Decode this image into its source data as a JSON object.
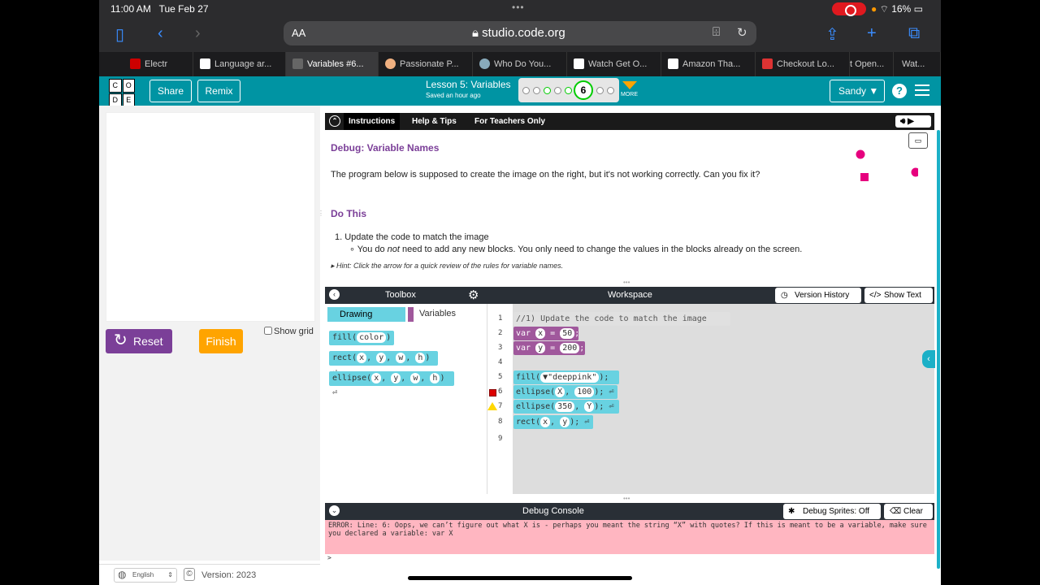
{
  "status": {
    "time": "11:00 AM",
    "date": "Tue Feb 27",
    "battery": "16%"
  },
  "safari": {
    "aa": "AA",
    "url": "studio.code.org"
  },
  "tabs": [
    {
      "label": "Electr",
      "color": "#c00"
    },
    {
      "label": "Language ar...",
      "color": "#fff"
    },
    {
      "label": "Variables #6...",
      "color": "#ccc",
      "active": true
    },
    {
      "label": "Passionate P...",
      "color": "#f0b080"
    },
    {
      "label": "Who Do You...",
      "color": "#8ab"
    },
    {
      "label": "Watch Get O...",
      "color": "#fff"
    },
    {
      "label": "Amazon Tha...",
      "color": "#fff"
    },
    {
      "label": "Checkout Lo...",
      "color": "#d33"
    },
    {
      "label": "t Open...",
      "color": "#1c1c1e"
    },
    {
      "label": "Wat...",
      "color": "#1c1c1e"
    }
  ],
  "header": {
    "logo": [
      "C",
      "O",
      "D",
      "E"
    ],
    "share": "Share",
    "remix": "Remix",
    "lesson_title": "Lesson 5: Variables",
    "saved": "Saved an hour ago",
    "current_level": "6",
    "more": "MORE",
    "user": "Sandy ▼",
    "help": "?"
  },
  "left": {
    "reset": "Reset",
    "finish": "Finish",
    "show_grid": "Show grid",
    "language": "English",
    "version": "Version: 2023"
  },
  "instructions": {
    "tabs": [
      "Instructions",
      "Help & Tips",
      "For Teachers Only"
    ],
    "title": "Debug: Variable Names",
    "body": "The program below is supposed to create the image on the right, but it's not working correctly. Can you fix it?",
    "do_this": "Do This",
    "step1": "1.  Update the code to match the image",
    "step1a_pre": "You do ",
    "step1a_em": "not",
    "step1a_post": " need to add any new blocks. You only need to change the values in the blocks already on the screen.",
    "hint": "▸ Hint: Click the arrow for a quick review of the rules for variable names."
  },
  "toolbox": {
    "title": "Toolbox",
    "cat_drawing": "Drawing",
    "cat_variables": "Variables",
    "blocks": [
      "fill",
      "rect",
      "ellipse"
    ]
  },
  "workspace": {
    "title": "Workspace",
    "version_history": "Version History",
    "show_text": "Show Text",
    "lines": [
      "1",
      "2",
      "3",
      "4",
      "5",
      "6",
      "7",
      "8",
      "9"
    ],
    "comment": "//1) Update the code to match the image",
    "code": {
      "var1_name": "x",
      "var1_val": "50",
      "var2_name": "y",
      "var2_val": "200",
      "fill_val": "▼\"deeppink\"",
      "ell1_a": "X",
      "ell1_b": "100",
      "ell2_a": "350",
      "ell2_b": "Y",
      "rect_a": "x",
      "rect_b": "y"
    }
  },
  "debug": {
    "title": "Debug Console",
    "sprites": "Debug Sprites: Off",
    "clear": "Clear",
    "error": "ERROR: Line: 6: Oops, we can’t figure out what X is - perhaps you meant the string “X” with quotes? If this is meant to be a variable, make sure you declared a variable: var X",
    "prompt": ">"
  },
  "colors": {
    "teal": "#0094a3",
    "purple": "#7b3f98",
    "orange": "#ffa400",
    "block_cyan": "#68d2e1",
    "block_purple": "#a0589c",
    "deeppink": "#e6007e"
  }
}
